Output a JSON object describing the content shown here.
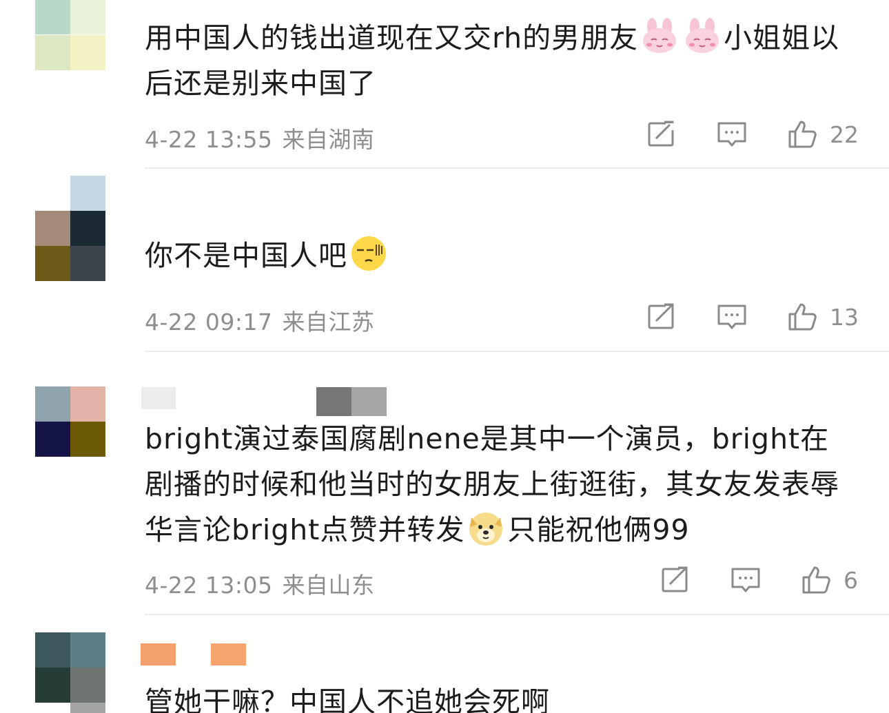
{
  "comments": [
    {
      "text_parts": [
        "用中国人的钱出道现在又交rh的男朋友",
        "小姐姐以后还是别来中国了"
      ],
      "emojis": [
        "bunny-shy-emoji",
        "bunny-shy-emoji"
      ],
      "date": "4-22 13:55",
      "location": "来自湖南",
      "likes": "22"
    },
    {
      "text_parts": [
        "你不是中国人吧"
      ],
      "emojis": [
        "sweat-face-emoji"
      ],
      "date": "4-22 09:17",
      "location": "来自江苏",
      "likes": "13"
    },
    {
      "text_parts": [
        "bright演过泰国腐剧nene是其中一个演员，bright在剧播的时候和他当时的女朋友上街逛街，其女友发表辱华言论bright点赞并转发",
        "只能祝他俩99"
      ],
      "emojis": [
        "doge-emoji"
      ],
      "date": "4-22 13:05",
      "location": "来自山东",
      "likes": "6"
    },
    {
      "text_parts": [
        "管她干嘛？中国人不追她会死啊"
      ],
      "emojis": []
    }
  ],
  "colors": {
    "meta_gray": "#8e8e8e",
    "divider": "#ececec",
    "text": "#1c1c1c"
  }
}
